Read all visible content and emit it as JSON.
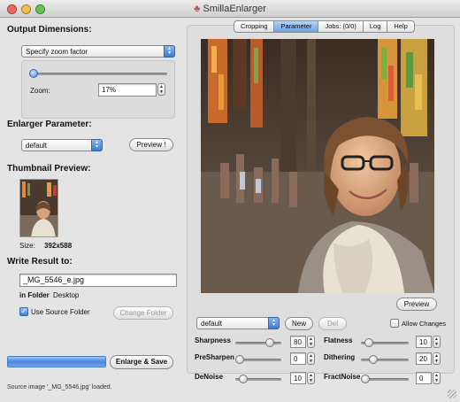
{
  "window": {
    "title": "SmillaEnlarger"
  },
  "output": {
    "heading": "Output Dimensions:",
    "mode": "Specify zoom factor",
    "zoom_label": "Zoom:",
    "zoom_value": "17%"
  },
  "enlarger": {
    "heading": "Enlarger Parameter:",
    "preset": "default",
    "preview_button": "Preview !"
  },
  "thumbnail": {
    "heading": "Thumbnail Preview:",
    "size_label": "Size:",
    "size_value": "392x588"
  },
  "write": {
    "heading": "Write Result to:",
    "filename": "_MG_5546_e.jpg",
    "folder_label": "in Folder",
    "folder_value": "Desktop",
    "use_source_label": "Use Source Folder",
    "use_source_checked": true,
    "change_folder_button": "Change Folder"
  },
  "action": {
    "enlarge_button": "Enlarge & Save",
    "progress": 1.0
  },
  "status": "Source image '_MG_5546.jpg' loaded.",
  "tabs": [
    {
      "label": "Cropping",
      "active": false
    },
    {
      "label": "Parameter",
      "active": true
    },
    {
      "label": "Jobs: (0/0)",
      "active": false
    },
    {
      "label": "Log",
      "active": false
    },
    {
      "label": "Help",
      "active": false
    }
  ],
  "preview_panel": {
    "preview_button": "Preview"
  },
  "params": {
    "preset": "default",
    "new_button": "New",
    "del_button": "Del",
    "allow_changes_label": "Allow Changes",
    "allow_changes_checked": false,
    "left": [
      {
        "label": "Sharpness",
        "value": "80",
        "level": 0.8
      },
      {
        "label": "PreSharpen",
        "value": "0",
        "level": 0.0
      },
      {
        "label": "DeNoise",
        "value": "10",
        "level": 0.1
      }
    ],
    "right": [
      {
        "label": "Flatness",
        "value": "10",
        "level": 0.1
      },
      {
        "label": "Dithering",
        "value": "20",
        "level": 0.2
      },
      {
        "label": "FractNoise",
        "value": "0",
        "level": 0.0
      }
    ]
  },
  "colors": {
    "accent": "#3c7ad6",
    "progress": "#5e98e6"
  }
}
